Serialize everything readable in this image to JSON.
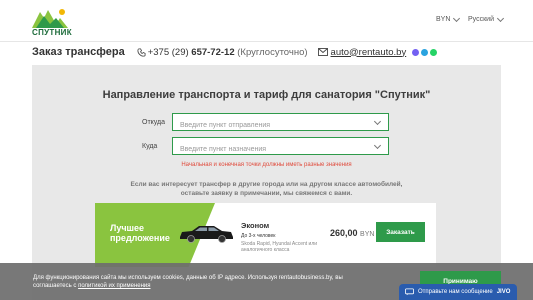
{
  "header": {
    "logo_text": "СПУТНИК",
    "currency": "BYN",
    "language": "Русский"
  },
  "title_row": {
    "page_title": "Заказ трансфера",
    "phone_prefix": "+375 (29) ",
    "phone_number": "657-72-12",
    "phone_hours": " (Круглосуточно)",
    "email": "auto@rentauto.by",
    "messenger_colors": [
      "#7360f2",
      "#2aa3df",
      "#25d366"
    ]
  },
  "form": {
    "heading": "Направление транспорта и тариф для санатория \"Спутник\"",
    "from_label": "Откуда",
    "from_placeholder": "Введите пункт отправления",
    "to_label": "Куда",
    "to_placeholder": "Введите пункт назначения",
    "error": "Начальная и конечная точки должны иметь разные значения",
    "note_line1": "Если вас интересует трансфер в другие города или на другом классе автомобилей,",
    "note_line2": "оставьте заявку в примечании, мы свяжемся с вами."
  },
  "tariff": {
    "badge_line1": "Лучшее",
    "badge_line2": "предложение",
    "class_name": "Эконом",
    "capacity": "До 3-х человек",
    "models": "Skoda Rapid, Hyundai Accent или аналогичного класса",
    "price": "260,00",
    "currency": "BYN",
    "order_label": "Заказать"
  },
  "cookie": {
    "text": "Для функционирования сайта мы используем cookies, данные об IP адресе. Используя rentautobusiness.by, вы соглашаетесь с ",
    "link": "политикой их применения",
    "accept_label": "Принимаю"
  },
  "chat": {
    "label": "Отправьте нам сообщение",
    "brand": "JIVO"
  },
  "colors": {
    "accent_green": "#2e9a4a",
    "badge_green": "#8ac43f",
    "error_red": "#e04a3b",
    "chat_blue": "#2a5cae"
  }
}
